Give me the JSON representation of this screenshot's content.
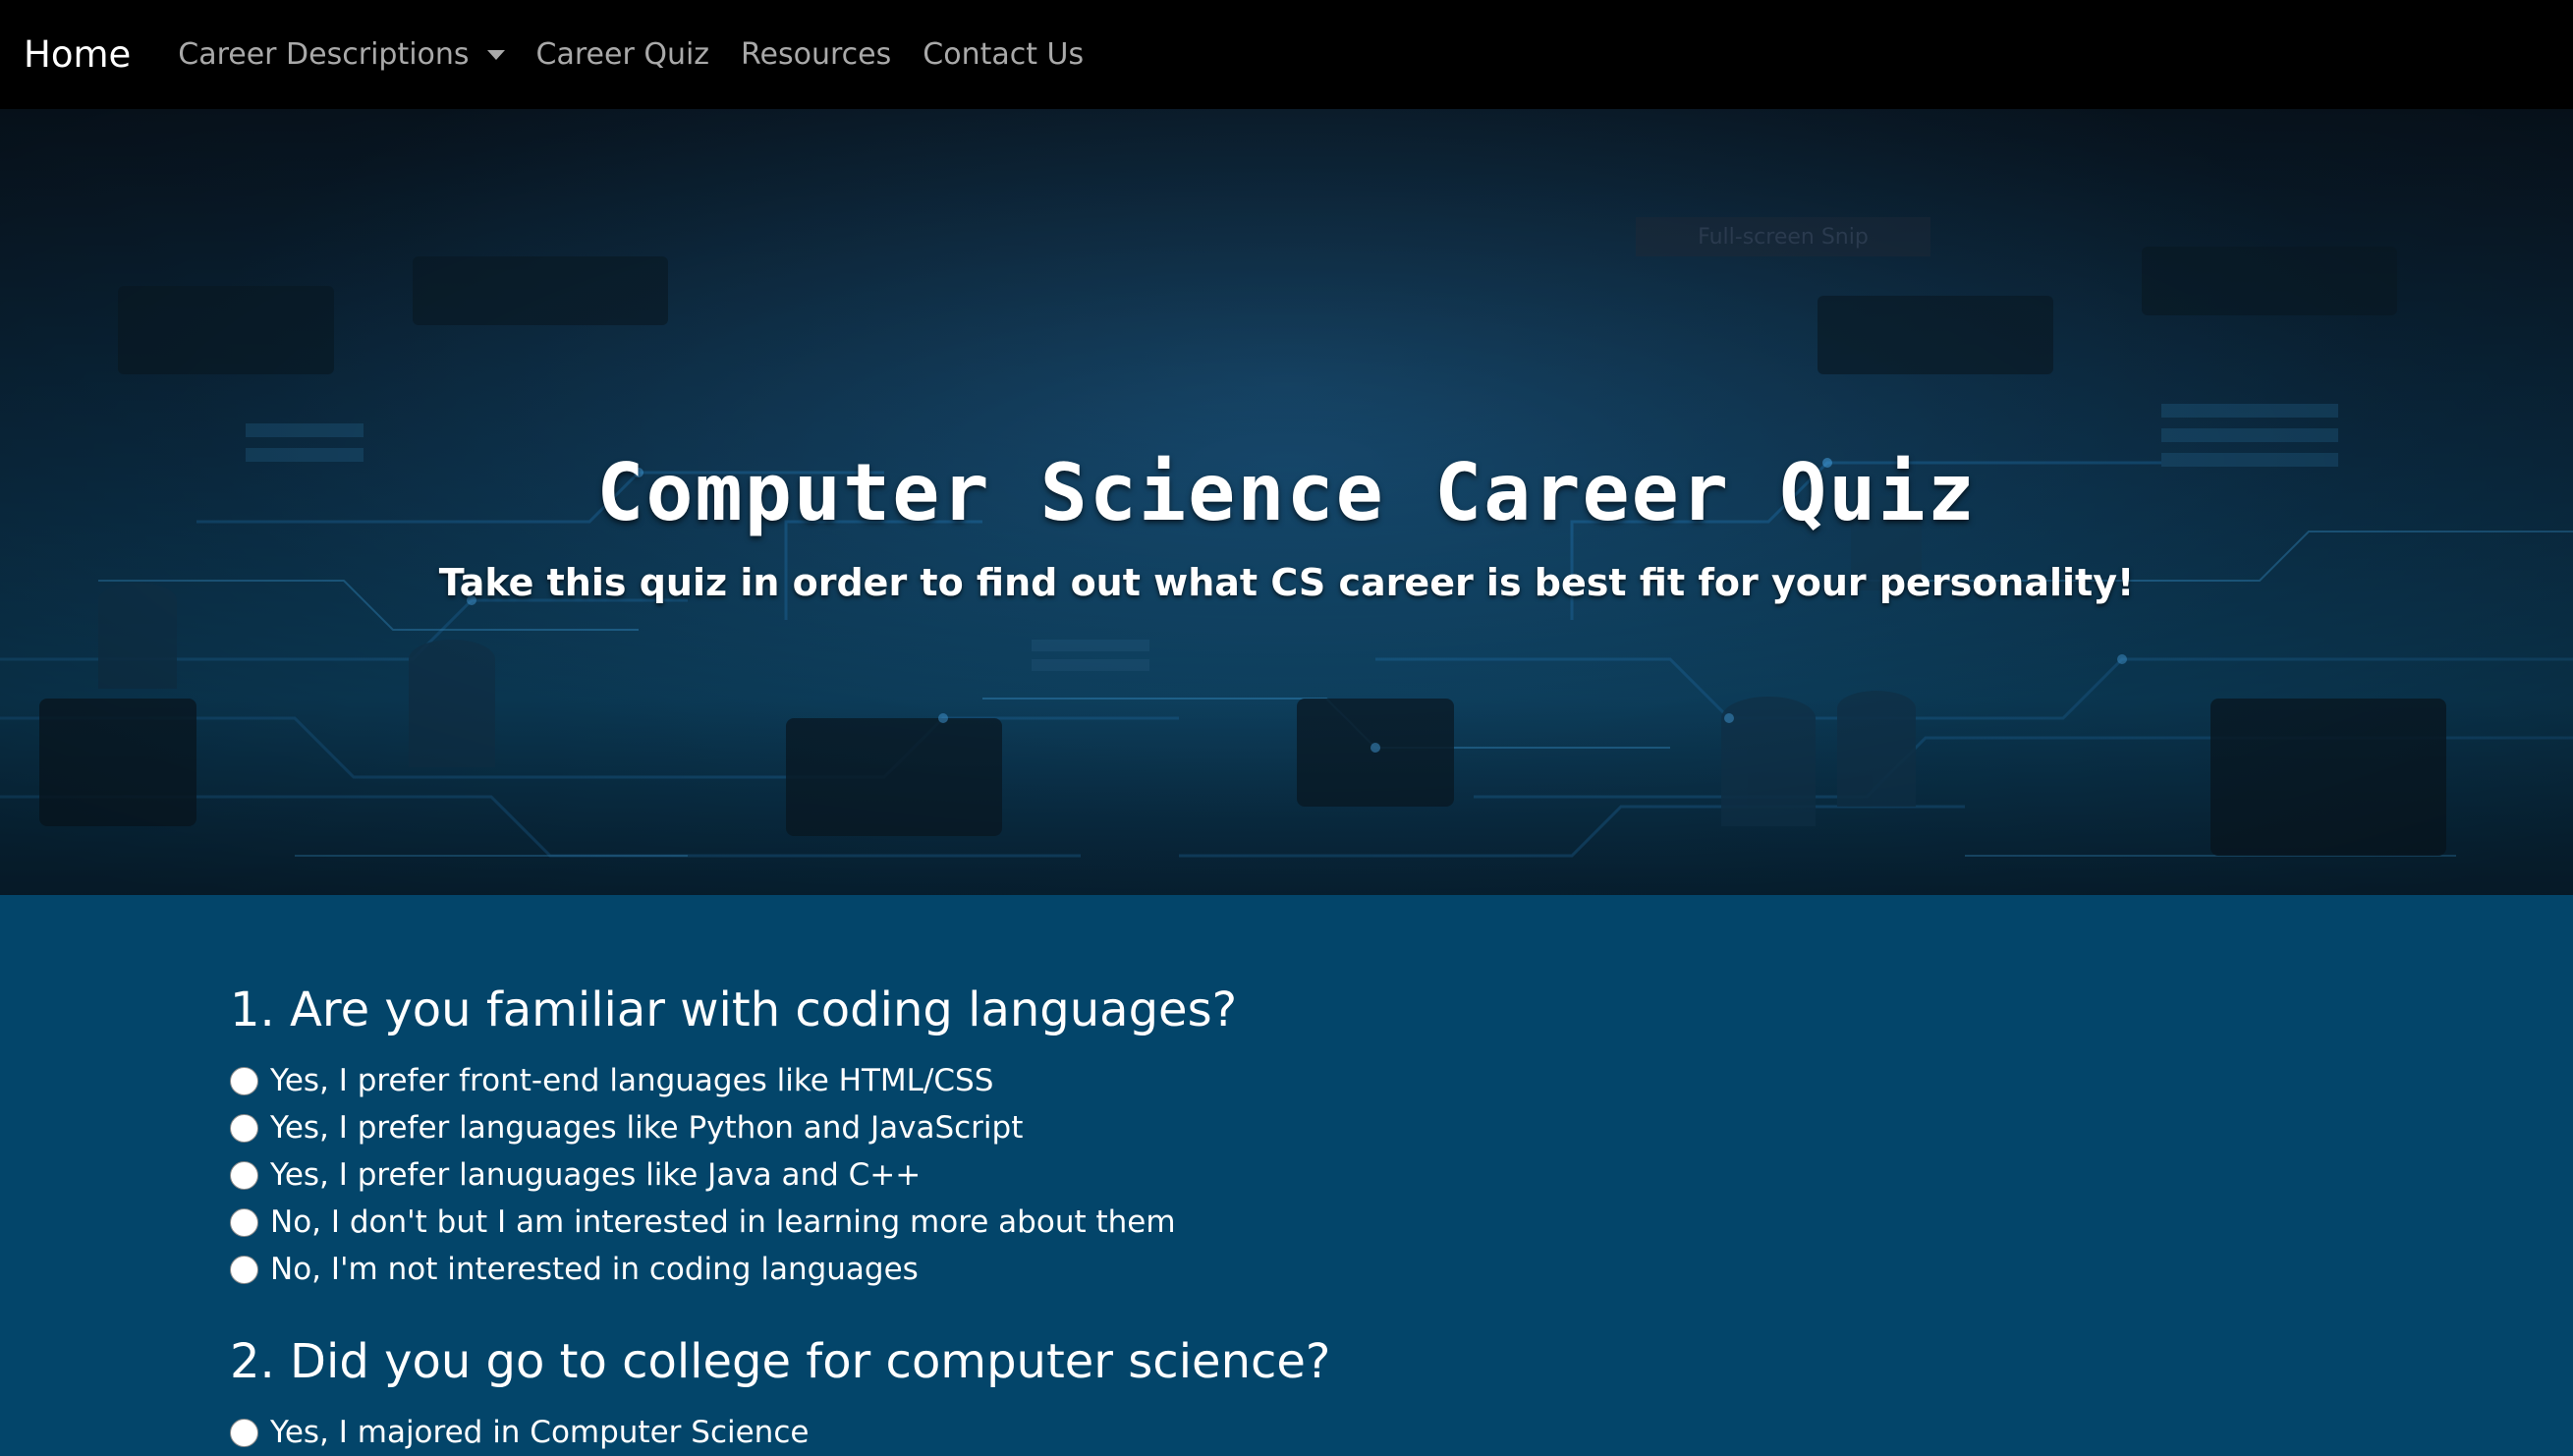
{
  "nav": {
    "brand": "Home",
    "items": [
      {
        "label": "Career Descriptions",
        "dropdown": true
      },
      {
        "label": "Career Quiz"
      },
      {
        "label": "Resources"
      },
      {
        "label": "Contact Us"
      }
    ]
  },
  "hero": {
    "overlay_label": "Full-screen Snip",
    "title": "Computer Science Career Quiz",
    "subtitle": "Take this quiz in order to find out what CS career is best fit for your personality!"
  },
  "quiz": {
    "questions": [
      {
        "text": "1. Are you familiar with coding languages?",
        "options": [
          "Yes, I prefer front-end languages like HTML/CSS",
          "Yes, I prefer languages like Python and JavaScript",
          "Yes, I prefer lanuguages like Java and C++",
          "No, I don't but I am interested in learning more about them",
          "No, I'm not interested in coding languages"
        ]
      },
      {
        "text": "2. Did you go to college for computer science?",
        "options": [
          "Yes, I majored in Computer Science"
        ]
      }
    ]
  },
  "colors": {
    "navbar": "#000000",
    "page_bg": "#03456a",
    "nav_text": "#a9a9a9"
  }
}
